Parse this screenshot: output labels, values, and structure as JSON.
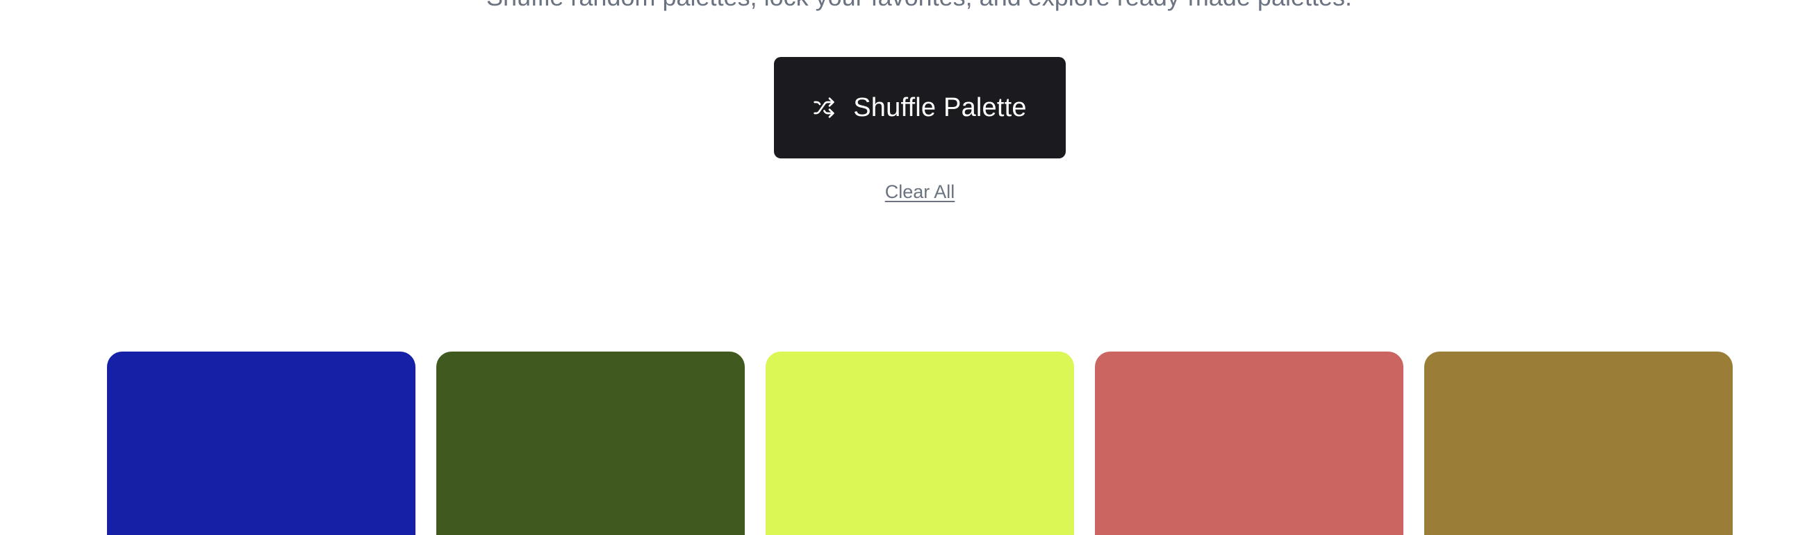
{
  "header": {
    "subtitle": "Shuffle random palettes, lock your favorites, and explore ready-made palettes."
  },
  "actions": {
    "shuffle_label": "Shuffle Palette",
    "shuffle_icon": "shuffle-icon",
    "clear_label": "Clear All"
  },
  "palette": {
    "colors": [
      "#1520a6",
      "#40591e",
      "#dbf755",
      "#cb6562",
      "#9a7d37"
    ]
  }
}
